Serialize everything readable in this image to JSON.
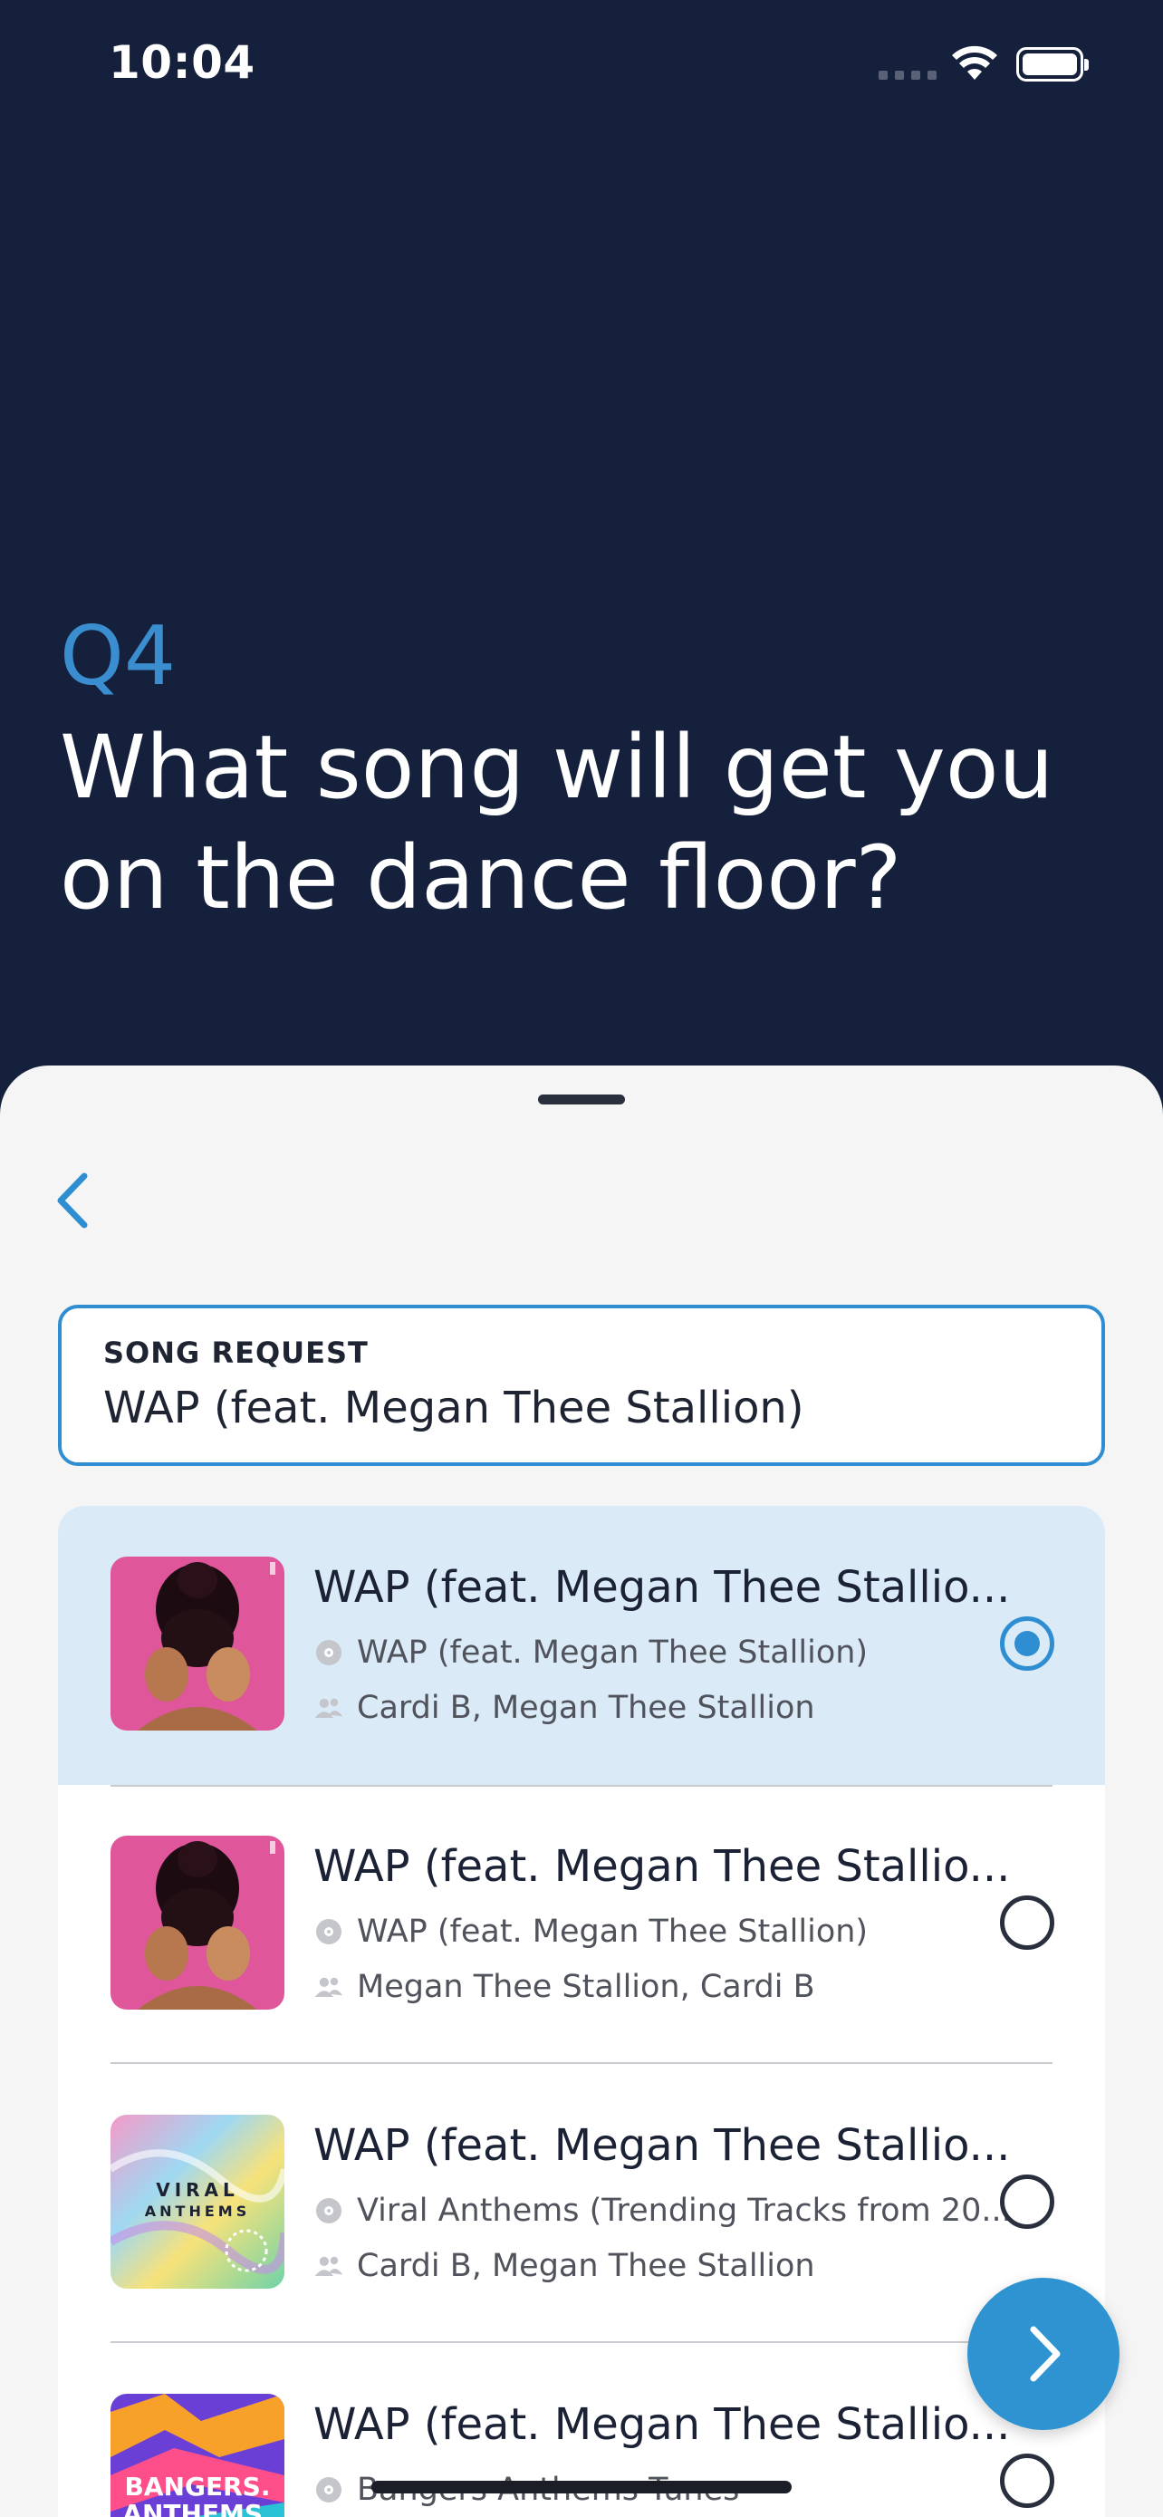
{
  "status_bar": {
    "time": "10:04"
  },
  "question": {
    "number": "Q4",
    "text": "What song will get you on the dance floor?"
  },
  "search": {
    "label": "SONG REQUEST",
    "value": "WAP (feat. Megan Thee Stallion)"
  },
  "results": [
    {
      "title": "WAP (feat. Megan Thee Stallio...",
      "album": "WAP (feat. Megan Thee Stallion)",
      "artists": "Cardi B, Megan Thee Stallion",
      "selected": true
    },
    {
      "title": "WAP (feat. Megan Thee Stallio...",
      "album": "WAP (feat. Megan Thee Stallion)",
      "artists": "Megan Thee Stallion, Cardi B",
      "selected": false
    },
    {
      "title": "WAP (feat. Megan Thee Stallio...",
      "album": "Viral Anthems (Trending Tracks from 20...",
      "artists": "Cardi B, Megan Thee Stallion",
      "art_text": "VIRAL ANTHEMS",
      "selected": false
    },
    {
      "title": "WAP (feat. Megan Thee Stallio...",
      "album": "Bangers Anthems Tunes",
      "art_text": "BANGERS. ANTHEMS. TUNES.",
      "selected": false
    }
  ],
  "colors": {
    "header_bg": "#15213c",
    "accent": "#2f8ed1",
    "selected_row": "#dbeaf7",
    "sheet_bg": "#f5f5f5"
  },
  "icons": {
    "back": "chevron-left-icon",
    "album": "disc-icon",
    "artist": "people-icon",
    "next": "chevron-right-icon"
  }
}
